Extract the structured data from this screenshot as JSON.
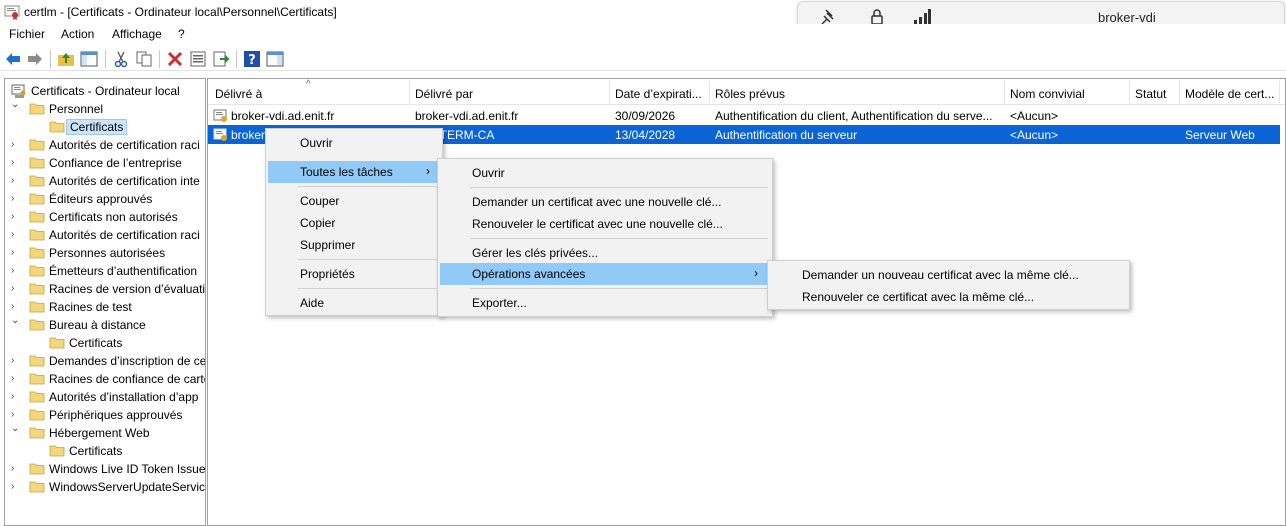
{
  "window": {
    "title": "certlm - [Certificats - Ordinateur local\\Personnel\\Certificats]"
  },
  "remote_bar": {
    "host": "broker-vdi"
  },
  "menubar": [
    "Fichier",
    "Action",
    "Affichage",
    "?"
  ],
  "tree": {
    "root": "Certificats - Ordinateur local",
    "items": [
      {
        "label": "Personnel",
        "level": 1,
        "expanded": true
      },
      {
        "label": "Certificats",
        "level": 2,
        "selected": true
      },
      {
        "label": "Autorités de certification raci",
        "level": 1
      },
      {
        "label": "Confiance de l’entreprise",
        "level": 1
      },
      {
        "label": "Autorités de certification inte",
        "level": 1
      },
      {
        "label": "Éditeurs approuvés",
        "level": 1
      },
      {
        "label": "Certificats non autorisés",
        "level": 1
      },
      {
        "label": "Autorités de certification raci",
        "level": 1
      },
      {
        "label": "Personnes autorisées",
        "level": 1
      },
      {
        "label": "Émetteurs d’authentification",
        "level": 1
      },
      {
        "label": "Racines de version d’évaluatio",
        "level": 1
      },
      {
        "label": "Racines de test",
        "level": 1
      },
      {
        "label": "Bureau à distance",
        "level": 1,
        "expanded": true
      },
      {
        "label": "Certificats",
        "level": 2
      },
      {
        "label": "Demandes d’inscription de ce",
        "level": 1
      },
      {
        "label": "Racines de confiance de carte",
        "level": 1
      },
      {
        "label": "Autorités d’installation d’app",
        "level": 1
      },
      {
        "label": "Périphériques approuvés",
        "level": 1
      },
      {
        "label": "Hébergement Web",
        "level": 1,
        "expanded": true
      },
      {
        "label": "Certificats",
        "level": 2
      },
      {
        "label": "Windows Live ID Token Issuer",
        "level": 1
      },
      {
        "label": "WindowsServerUpdateServices",
        "level": 1
      }
    ]
  },
  "list": {
    "columns": [
      "Délivré à",
      "Délivré par",
      "Date d’expirati...",
      "Rôles prévus",
      "Nom convivial",
      "Statut",
      "Modèle de cert..."
    ],
    "rows": [
      {
        "issued_to": "broker-vdi.ad.enit.fr",
        "issued_by": "broker-vdi.ad.enit.fr",
        "expiry": "30/09/2026",
        "roles": "Authentification du client, Authentification du serve...",
        "friendly": "<Aucun>",
        "status": "",
        "template": ""
      },
      {
        "issued_to": "broker",
        "issued_by": "C-INTERM-CA",
        "expiry": "13/04/2028",
        "roles": "Authentification du serveur",
        "friendly": "<Aucun>",
        "status": "",
        "template": "Serveur Web",
        "selected": true
      }
    ]
  },
  "context_menu": {
    "open": "Ouvrir",
    "all_tasks": "Toutes les tâches",
    "cut": "Couper",
    "copy": "Copier",
    "delete": "Supprimer",
    "properties": "Propriétés",
    "help": "Aide"
  },
  "tasks_menu": {
    "open": "Ouvrir",
    "request_new_key": "Demander un certificat avec une nouvelle clé...",
    "renew_new_key": "Renouveler le certificat avec une nouvelle clé...",
    "manage_keys": "Gérer les clés privées...",
    "advanced": "Opérations avancées",
    "export": "Exporter..."
  },
  "advanced_menu": {
    "request_same_key": "Demander un nouveau certificat avec la même clé...",
    "renew_same_key": "Renouveler ce certificat avec la même clé..."
  },
  "colors": {
    "selection": "#0a64d6",
    "menu_highlight": "#91c9f7",
    "menu_bg": "#f2f2f2"
  }
}
